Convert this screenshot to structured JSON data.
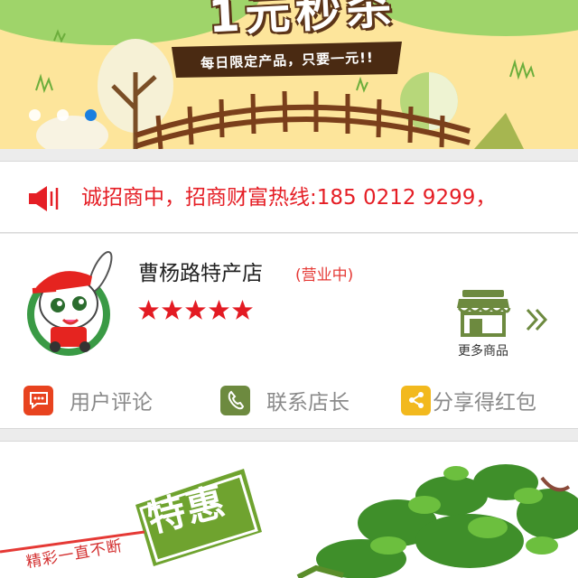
{
  "banner": {
    "title": "1元秒杀",
    "subtitle": "每日限定产品，只要一元!!",
    "carousel": {
      "count": 3,
      "active_index": 2
    }
  },
  "announcement": {
    "text": "诚招商中，招商财富热线:185 0212 9299，"
  },
  "store": {
    "name": "曹杨路特产店",
    "status": "(营业中)",
    "rating": 5,
    "more_label": "更多商品"
  },
  "actions": [
    {
      "label": "用户评论",
      "icon": "comment-icon",
      "color": "#e8431f"
    },
    {
      "label": "联系店长",
      "icon": "phone-icon",
      "color": "#6d8a3f"
    },
    {
      "label": "分享得红包",
      "icon": "share-icon",
      "color": "#f2b91e"
    }
  ],
  "promo": {
    "badge": "特惠",
    "tagline": "精彩一直不断"
  },
  "colors": {
    "accent_red": "#e51e25",
    "active_dot": "#1a7fe0",
    "star": "#e31b23"
  }
}
